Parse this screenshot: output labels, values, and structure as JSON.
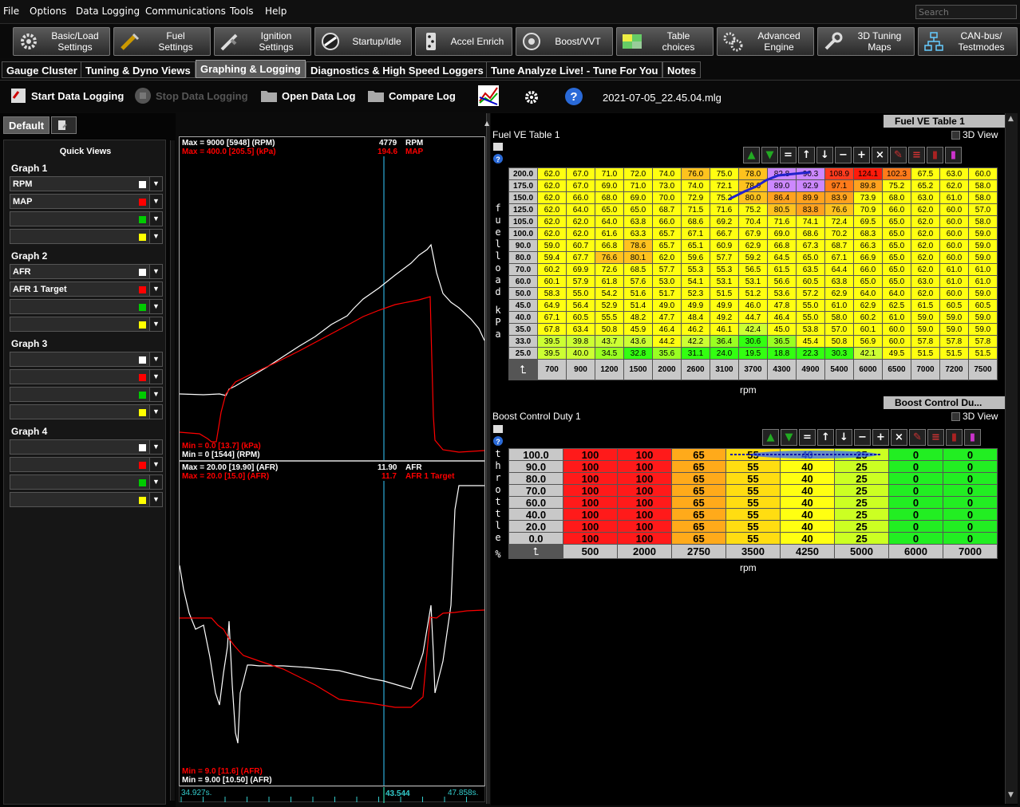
{
  "menu": {
    "items": [
      "File",
      "Options",
      "Data Logging",
      "Communications",
      "Tools",
      "Help"
    ],
    "search_placeholder": "Search"
  },
  "toolbar": [
    {
      "label": "Basic/Load\nSettings",
      "icon": "gears-icon"
    },
    {
      "label": "Fuel\nSettings",
      "icon": "injector-icon"
    },
    {
      "label": "Ignition\nSettings",
      "icon": "spark-plug-icon"
    },
    {
      "label": "Startup/Idle",
      "icon": "gauge-needle-icon"
    },
    {
      "label": "Accel Enrich",
      "icon": "dice-icon"
    },
    {
      "label": "Boost/VVT",
      "icon": "turbo-icon"
    },
    {
      "label": "Table\nchoices",
      "icon": "table-color-icon"
    },
    {
      "label": "Advanced\nEngine",
      "icon": "advanced-gears-icon"
    },
    {
      "label": "3D Tuning\nMaps",
      "icon": "wrench-icon"
    },
    {
      "label": "CAN-bus/\nTestmodes",
      "icon": "network-icon"
    }
  ],
  "tabs": [
    "Gauge Cluster",
    "Tuning & Dyno Views",
    "Graphing & Logging",
    "Diagnostics & High Speed Loggers",
    "Tune Analyze Live! - Tune For You",
    "Notes"
  ],
  "actions": {
    "start": "Start Data Logging",
    "stop": "Stop Data Logging",
    "open": "Open Data Log",
    "compare": "Compare Log",
    "filename": "2021-07-05_22.45.04.mlg"
  },
  "left": {
    "tab": "Default",
    "quick_views": "Quick Views",
    "graphs": [
      {
        "title": "Graph 1",
        "rows": [
          {
            "label": "RPM",
            "color": "#ffffff"
          },
          {
            "label": "MAP",
            "color": "#ff0000"
          },
          {
            "label": "",
            "color": "#00cc00"
          },
          {
            "label": "",
            "color": "#ffff00"
          }
        ]
      },
      {
        "title": "Graph 2",
        "rows": [
          {
            "label": "AFR",
            "color": "#ffffff"
          },
          {
            "label": "AFR 1 Target",
            "color": "#ff0000"
          },
          {
            "label": "",
            "color": "#00cc00"
          },
          {
            "label": "",
            "color": "#ffff00"
          }
        ]
      },
      {
        "title": "Graph 3",
        "rows": [
          {
            "label": "",
            "color": "#ffffff"
          },
          {
            "label": "",
            "color": "#ff0000"
          },
          {
            "label": "",
            "color": "#00cc00"
          },
          {
            "label": "",
            "color": "#ffff00"
          }
        ]
      },
      {
        "title": "Graph 4",
        "rows": [
          {
            "label": "",
            "color": "#ffffff"
          },
          {
            "label": "",
            "color": "#ff0000"
          },
          {
            "label": "",
            "color": "#00cc00"
          },
          {
            "label": "",
            "color": "#ffff00"
          }
        ]
      }
    ]
  },
  "graph1": {
    "max_rpm": "Max = 9000 [5948] (RPM)",
    "max_map": "Max = 400.0 [205.5] (kPa)",
    "cur_rpm": "4779",
    "rpm_lbl": "RPM",
    "cur_map": "194.6",
    "map_lbl": "MAP",
    "min_map": "Min = 0.0 [13.7] (kPa)",
    "min_rpm": "Min = 0 [1544] (RPM)"
  },
  "graph2": {
    "max_afr": "Max = 20.00 [19.90] (AFR)",
    "max_tgt": "Max = 20.0 [15.0] (AFR)",
    "cur_afr": "11.90",
    "afr_lbl": "AFR",
    "cur_tgt": "11.7",
    "tgt_lbl": "AFR 1 Target",
    "min_tgt": "Min = 9.0 [11.6] (AFR)",
    "min_afr": "Min = 9.00 [10.50] (AFR)"
  },
  "timeline": {
    "start": "34.927s.",
    "cursor": "43.544",
    "end": "47.858s."
  },
  "ve": {
    "tab": "Fuel VE Table 1",
    "title": "Fuel VE Table 1",
    "view3d": "3D View",
    "y_axis_label": "fuelload kPa",
    "x_axis_label": "rpm",
    "rows": [
      "200.0",
      "175.0",
      "150.0",
      "125.0",
      "105.0",
      "100.0",
      "90.0",
      "80.0",
      "70.0",
      "60.0",
      "50.0",
      "45.0",
      "40.0",
      "35.0",
      "33.0",
      "25.0"
    ],
    "cols": [
      "700",
      "900",
      "1200",
      "1500",
      "2000",
      "2600",
      "3100",
      "3700",
      "4300",
      "4900",
      "5400",
      "6000",
      "6500",
      "7000",
      "7200",
      "7500"
    ],
    "values": [
      [
        "62.0",
        "67.0",
        "71.0",
        "72.0",
        "74.0",
        "76.0",
        "75.0",
        "78.0",
        "82.8",
        "90.3",
        "108.9",
        "124.1",
        "102.3",
        "67.5",
        "63.0",
        "60.0"
      ],
      [
        "62.0",
        "67.0",
        "69.0",
        "71.0",
        "73.0",
        "74.0",
        "72.1",
        "78.0",
        "89.0",
        "92.9",
        "97.1",
        "89.8",
        "75.2",
        "65.2",
        "62.0",
        "58.0"
      ],
      [
        "62.0",
        "66.0",
        "68.0",
        "69.0",
        "70.0",
        "72.9",
        "75.2",
        "80.0",
        "86.4",
        "89.9",
        "83.9",
        "73.9",
        "68.0",
        "63.0",
        "61.0",
        "58.0"
      ],
      [
        "62.0",
        "64.0",
        "65.0",
        "65.0",
        "68.7",
        "71.5",
        "71.6",
        "75.2",
        "80.5",
        "83.8",
        "76.6",
        "70.9",
        "66.0",
        "62.0",
        "60.0",
        "57.0"
      ],
      [
        "62.0",
        "62.0",
        "64.0",
        "63.8",
        "66.0",
        "68.6",
        "69.2",
        "70.4",
        "71.6",
        "74.1",
        "72.4",
        "69.5",
        "65.0",
        "62.0",
        "60.0",
        "58.0"
      ],
      [
        "62.0",
        "62.0",
        "61.6",
        "63.3",
        "65.7",
        "67.1",
        "66.7",
        "67.9",
        "69.0",
        "68.6",
        "70.2",
        "68.3",
        "65.0",
        "62.0",
        "60.0",
        "59.0"
      ],
      [
        "59.0",
        "60.7",
        "66.8",
        "78.6",
        "65.7",
        "65.1",
        "60.9",
        "62.9",
        "66.8",
        "67.3",
        "68.7",
        "66.3",
        "65.0",
        "62.0",
        "60.0",
        "59.0"
      ],
      [
        "59.4",
        "67.7",
        "76.6",
        "80.1",
        "62.0",
        "59.6",
        "57.7",
        "59.2",
        "64.5",
        "65.0",
        "67.1",
        "66.9",
        "65.0",
        "62.0",
        "60.0",
        "59.0"
      ],
      [
        "60.2",
        "69.9",
        "72.6",
        "68.5",
        "57.7",
        "55.3",
        "55.3",
        "56.5",
        "61.5",
        "63.5",
        "64.4",
        "66.0",
        "65.0",
        "62.0",
        "61.0",
        "61.0"
      ],
      [
        "60.1",
        "57.9",
        "61.8",
        "57.6",
        "53.0",
        "54.1",
        "53.1",
        "53.1",
        "56.6",
        "60.5",
        "63.8",
        "65.0",
        "65.0",
        "63.0",
        "61.0",
        "61.0"
      ],
      [
        "58.3",
        "55.0",
        "54.2",
        "51.6",
        "51.7",
        "52.3",
        "51.5",
        "51.2",
        "53.6",
        "57.2",
        "62.9",
        "64.0",
        "64.0",
        "62.0",
        "60.0",
        "59.0"
      ],
      [
        "64.9",
        "56.4",
        "52.9",
        "51.4",
        "49.0",
        "49.9",
        "49.9",
        "46.0",
        "47.8",
        "55.0",
        "61.0",
        "62.9",
        "62.5",
        "61.5",
        "60.5",
        "60.5"
      ],
      [
        "67.1",
        "60.5",
        "55.5",
        "48.2",
        "47.7",
        "48.4",
        "49.2",
        "44.7",
        "46.4",
        "55.0",
        "58.0",
        "60.2",
        "61.0",
        "59.0",
        "59.0",
        "59.0"
      ],
      [
        "67.8",
        "63.4",
        "50.8",
        "45.9",
        "46.4",
        "46.2",
        "46.1",
        "42.4",
        "45.0",
        "53.8",
        "57.0",
        "60.1",
        "60.0",
        "59.0",
        "59.0",
        "59.0"
      ],
      [
        "39.5",
        "39.8",
        "43.7",
        "43.6",
        "44.2",
        "42.2",
        "36.4",
        "30.6",
        "36.5",
        "45.4",
        "50.8",
        "56.9",
        "60.0",
        "57.8",
        "57.8",
        "57.8"
      ],
      [
        "39.5",
        "40.0",
        "34.5",
        "32.8",
        "35.6",
        "31.1",
        "24.0",
        "19.5",
        "18.8",
        "22.3",
        "30.3",
        "42.1",
        "49.5",
        "51.5",
        "51.5",
        "51.5"
      ]
    ],
    "highlight_color": "#cc88ff"
  },
  "boost": {
    "tab": "Boost Control Du...",
    "title": "Boost Control Duty 1",
    "view3d": "3D View",
    "y_axis_label": "throttle %",
    "x_axis_label": "rpm",
    "rows": [
      "100.0",
      "90.0",
      "80.0",
      "70.0",
      "60.0",
      "40.0",
      "20.0",
      "0.0"
    ],
    "cols": [
      "500",
      "2000",
      "2750",
      "3500",
      "4250",
      "5000",
      "6000",
      "7000"
    ],
    "values": [
      [
        "100",
        "100",
        "65",
        "55",
        "40",
        "25",
        "0",
        "0"
      ],
      [
        "100",
        "100",
        "65",
        "55",
        "40",
        "25",
        "0",
        "0"
      ],
      [
        "100",
        "100",
        "65",
        "55",
        "40",
        "25",
        "0",
        "0"
      ],
      [
        "100",
        "100",
        "65",
        "55",
        "40",
        "25",
        "0",
        "0"
      ],
      [
        "100",
        "100",
        "65",
        "55",
        "40",
        "25",
        "0",
        "0"
      ],
      [
        "100",
        "100",
        "65",
        "55",
        "40",
        "25",
        "0",
        "0"
      ],
      [
        "100",
        "100",
        "65",
        "55",
        "40",
        "25",
        "0",
        "0"
      ],
      [
        "100",
        "100",
        "65",
        "55",
        "40",
        "25",
        "0",
        "0"
      ]
    ]
  }
}
